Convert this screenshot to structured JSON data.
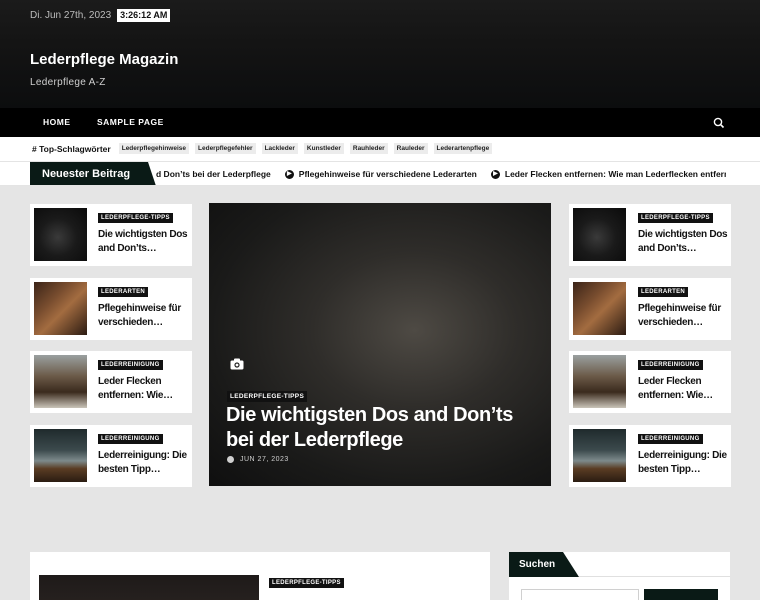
{
  "topbar": {
    "date": "Di. Jun 27th, 2023",
    "time": "3:26:12 AM"
  },
  "site": {
    "title": "Lederpflege Magazin",
    "tagline": "Lederpflege A-Z"
  },
  "nav": {
    "items": [
      "HOME",
      "SAMPLE PAGE"
    ],
    "search_icon": "search-icon"
  },
  "tags": {
    "title": "# Top-Schlagwörter",
    "items": [
      "Lederpflegehinweise",
      "Lederpflegefehler",
      "Lackleder",
      "Kunstleder",
      "Rauhleder",
      "Rauleder",
      "Lederartenpflege"
    ]
  },
  "ticker": {
    "label": "Neuester Beitrag",
    "items": [
      "d Don’ts bei der Lederpflege",
      "Pflegehinweise für verschiedene Lederarten",
      "Leder Flecken entfernen: Wie man Lederflecken entfernt"
    ]
  },
  "cards_left": [
    {
      "category": "LEDERPFLEGE-TIPPS",
      "title": "Die wichtigsten Dos and Don’ts…"
    },
    {
      "category": "LEDERARTEN",
      "title": "Pflegehinweise für verschieden…"
    },
    {
      "category": "LEDERREINIGUNG",
      "title": "Leder Flecken entfernen: Wie…"
    },
    {
      "category": "LEDERREINIGUNG",
      "title": "Lederreinigung: Die besten Tipp…"
    }
  ],
  "cards_right": [
    {
      "category": "LEDERPFLEGE-TIPPS",
      "title": "Die wichtigsten Dos and Don’ts…"
    },
    {
      "category": "LEDERARTEN",
      "title": "Pflegehinweise für verschieden…"
    },
    {
      "category": "LEDERREINIGUNG",
      "title": "Leder Flecken entfernen: Wie…"
    },
    {
      "category": "LEDERREINIGUNG",
      "title": "Lederreinigung: Die besten Tipp…"
    }
  ],
  "hero": {
    "category": "LEDERPFLEGE-TIPPS",
    "title": "Die wichtigsten Dos and Don’ts bei der Lederpflege",
    "date": "JUN 27, 2023"
  },
  "latest_post": {
    "category": "LEDERPFLEGE-TIPPS"
  },
  "sidebar": {
    "title": "Suchen"
  },
  "colors": {
    "accent": "#0a1a16",
    "header_bg": "#141414",
    "nav_bg": "#000000",
    "page_bg": "#e5e5e5"
  }
}
